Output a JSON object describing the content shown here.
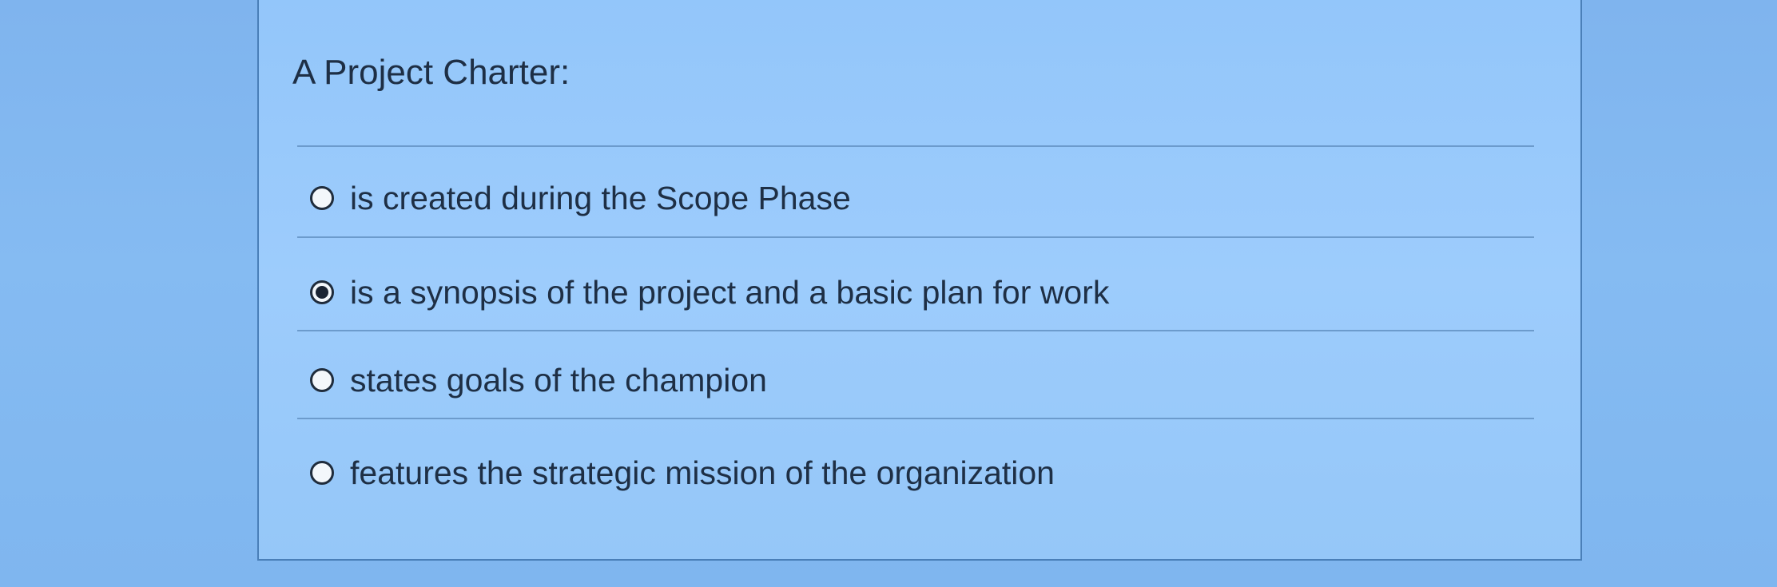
{
  "question": {
    "title": "A Project Charter:"
  },
  "options": [
    {
      "label": "is created during the Scope Phase",
      "selected": false,
      "icon": "radio-unselected-icon"
    },
    {
      "label": "is a synopsis of the project and a basic plan for work",
      "selected": true,
      "icon": "radio-selected-icon"
    },
    {
      "label": "states goals of the champion",
      "selected": false,
      "icon": "radio-unselected-icon"
    },
    {
      "label": "features the strategic mission of the organization",
      "selected": false,
      "icon": "radio-unselected-icon"
    }
  ],
  "colors": {
    "background": "#85bbf2",
    "card": "#9dccfc",
    "border": "#4a7fb8",
    "text": "#1e2f45"
  }
}
